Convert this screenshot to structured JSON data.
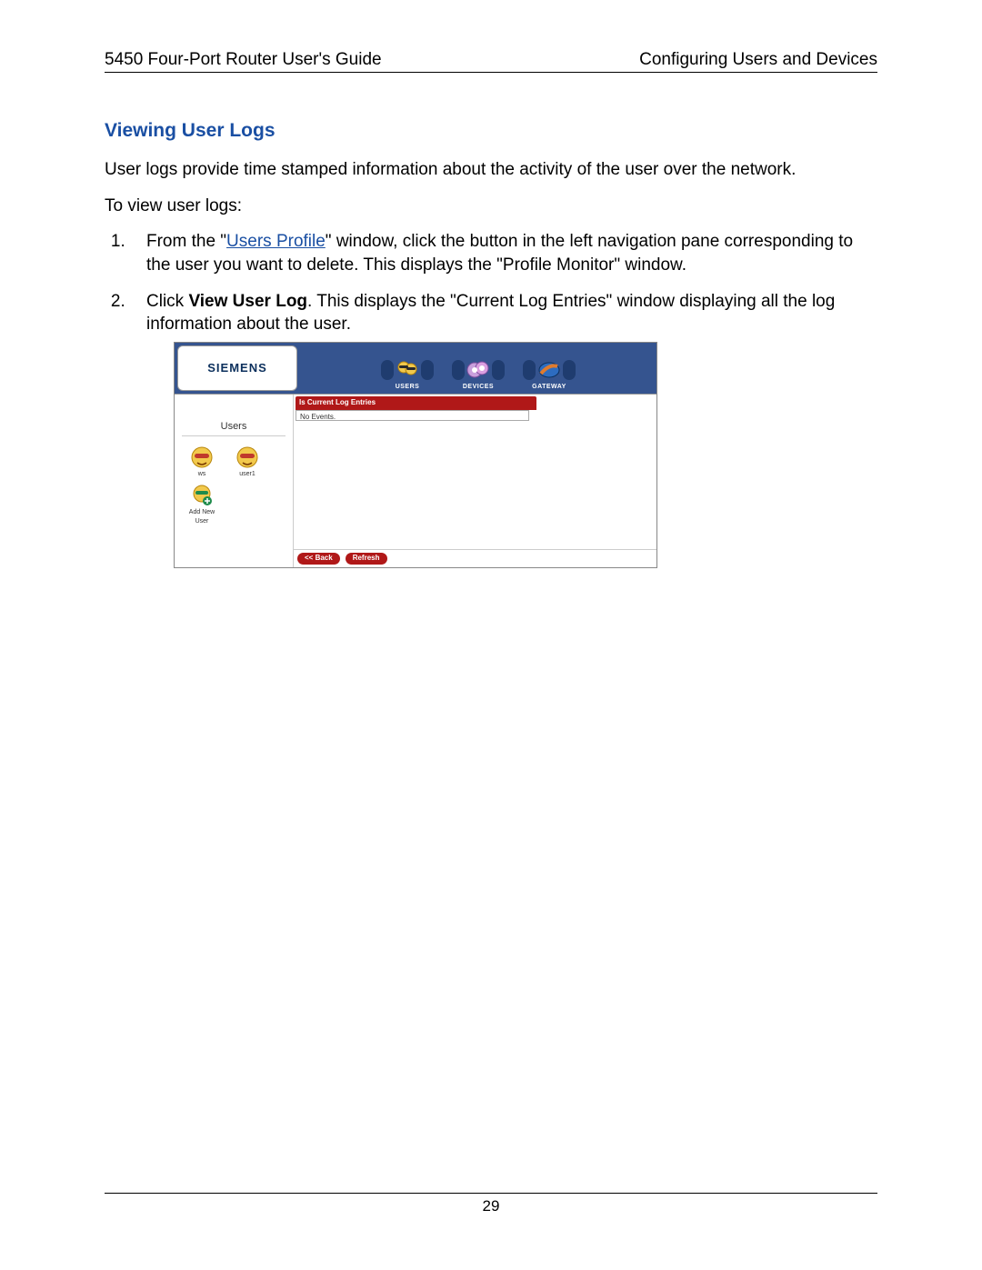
{
  "header": {
    "left": "5450 Four-Port Router User's Guide",
    "right": "Configuring Users and Devices"
  },
  "section_title": "Viewing User Logs",
  "intro_para": "User logs provide time stamped information about the activity of the user over the network.",
  "lead_in": "To view user logs:",
  "steps": {
    "s1_a": "From the \"",
    "s1_link": "Users Profile",
    "s1_b": "\" window, click the button in the left navigation pane corresponding to the user you want to delete. This displays the \"Profile Monitor\" window.",
    "s2_a": "Click ",
    "s2_bold": "View User Log",
    "s2_b": ". This displays the \"Current Log Entries\" window displaying all the log information about the user."
  },
  "figure": {
    "logo": "SIEMENS",
    "topnav": {
      "users": "USERS",
      "devices": "DEVICES",
      "gateway": "GATEWAY"
    },
    "sidebar": {
      "title": "Users",
      "items": [
        {
          "label": "ws"
        },
        {
          "label": "user1"
        },
        {
          "label": "Add New User"
        }
      ]
    },
    "main": {
      "header": "Current Log Entries",
      "header_prefix": "Is",
      "body": "No Events."
    },
    "footer": {
      "back": "<< Back",
      "refresh": "Refresh"
    }
  },
  "page_number": "29"
}
